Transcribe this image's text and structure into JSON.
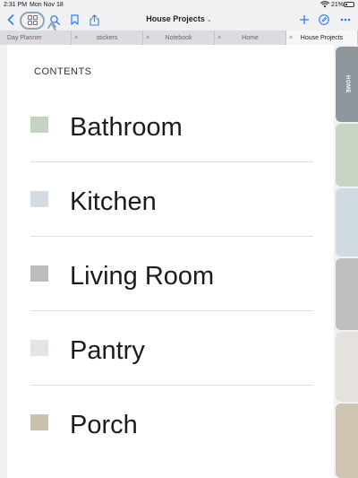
{
  "status_bar": {
    "time": "2:31 PM",
    "date": "Mon Nov 18",
    "battery": "21%"
  },
  "toolbar": {
    "title": "House Projects",
    "title_chevron": "⌄"
  },
  "tabs": [
    {
      "label": "Day Planner",
      "close": "×"
    },
    {
      "label": "stickers",
      "close": "×"
    },
    {
      "label": "Notebook",
      "close": "×"
    },
    {
      "label": "Home",
      "close": "×"
    },
    {
      "label": "House Projects",
      "close": "×"
    }
  ],
  "page": {
    "heading": "CONTENTS",
    "entries": [
      {
        "label": "Bathroom",
        "color": "#c5d4c1"
      },
      {
        "label": "Kitchen",
        "color": "#d3dce3"
      },
      {
        "label": "Living Room",
        "color": "#bcbcbc"
      },
      {
        "label": "Pantry",
        "color": "#e6e4e0"
      },
      {
        "label": "Porch",
        "color": "#cbbfaf"
      }
    ]
  },
  "side_tabs": [
    {
      "label": "HOME",
      "color": "#8e979c"
    },
    {
      "label": "",
      "color": "#c7d4c3"
    },
    {
      "label": "",
      "color": "#d0dae1"
    },
    {
      "label": "",
      "color": "#bebfbf"
    },
    {
      "label": "",
      "color": "#e5e2de"
    },
    {
      "label": "",
      "color": "#cfc3b2"
    }
  ],
  "colors": {
    "accent": "#2f7bf5",
    "highlight_ring": "#8fa7b7"
  }
}
